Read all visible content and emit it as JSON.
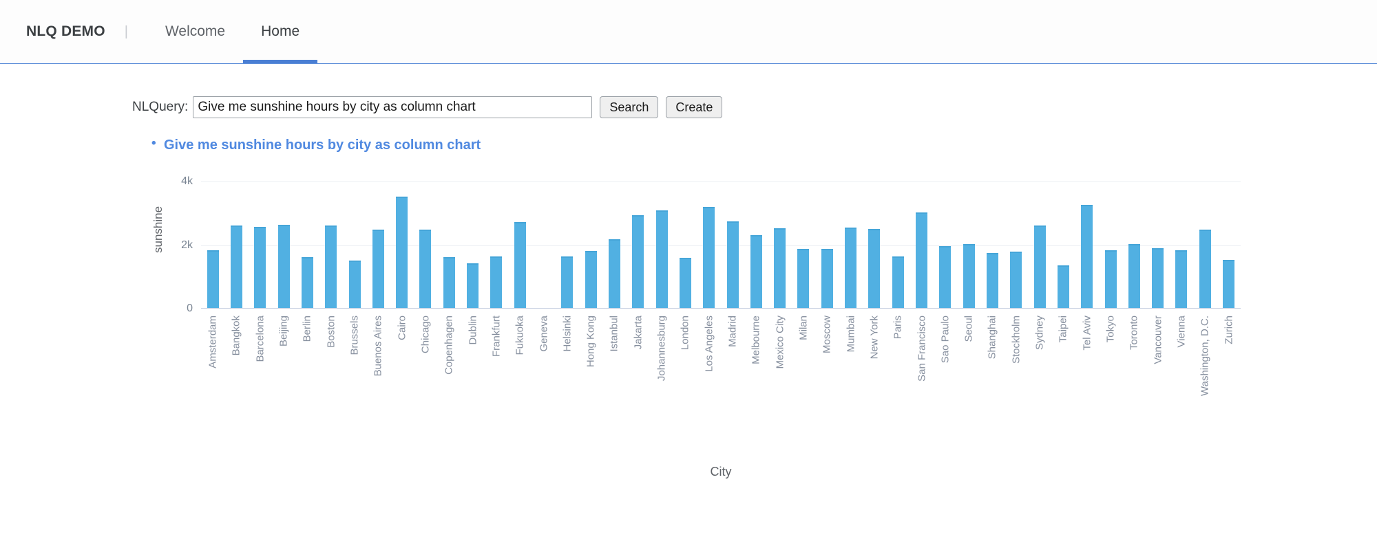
{
  "navbar": {
    "brand": "NLQ DEMO",
    "separator": "|",
    "links": [
      {
        "label": "Welcome"
      },
      {
        "label": "Home"
      }
    ]
  },
  "query": {
    "label": "NLQuery:",
    "value": "Give me sunshine hours by city as column chart",
    "placeholder": "",
    "search_label": "Search",
    "create_label": "Create"
  },
  "results": [
    {
      "text": "Give me sunshine hours by city as column chart"
    }
  ],
  "colors": {
    "bar": "#51b0e2",
    "accent": "#4a7fd4",
    "link": "#5089e0"
  },
  "chart_data": {
    "type": "bar",
    "title": "",
    "xlabel": "City",
    "ylabel": "sunshine",
    "ylim": [
      0,
      4000
    ],
    "yticks": [
      0,
      2000,
      4000
    ],
    "ytick_labels": [
      "0",
      "2k",
      "4k"
    ],
    "grid": true,
    "legend": "none",
    "categories": [
      "Amsterdam",
      "Bangkok",
      "Barcelona",
      "Beijing",
      "Berlin",
      "Boston",
      "Brussels",
      "Buenos Aires",
      "Cairo",
      "Chicago",
      "Copenhagen",
      "Dublin",
      "Frankfurt",
      "Fukuoka",
      "Geneva",
      "Helsinki",
      "Hong Kong",
      "Istanbul",
      "Jakarta",
      "Johannesburg",
      "London",
      "Los Angeles",
      "Madrid",
      "Melbourne",
      "Mexico City",
      "Milan",
      "Moscow",
      "Mumbai",
      "New York",
      "Paris",
      "San Francisco",
      "Sao Paulo",
      "Seoul",
      "Shanghai",
      "Stockholm",
      "Sydney",
      "Taipei",
      "Tel Aviv",
      "Tokyo",
      "Toronto",
      "Vancouver",
      "Vienna",
      "Washington, D.C.",
      "Zurich"
    ],
    "values": [
      1811,
      2602,
      2551,
      2624,
      1594,
      2602,
      1500,
      2463,
      3507,
      2463,
      1594,
      1413,
      1624,
      2711,
      null,
      1630,
      1790,
      2152,
      2913,
      3072,
      1587,
      3189,
      2724,
      2297,
      2515,
      1862,
      1862,
      2537,
      2493,
      1624,
      3000,
      1950,
      2007,
      1733,
      1768,
      2587,
      1333,
      3254,
      1826,
      2007,
      1877,
      1826,
      2463,
      1515
    ]
  }
}
